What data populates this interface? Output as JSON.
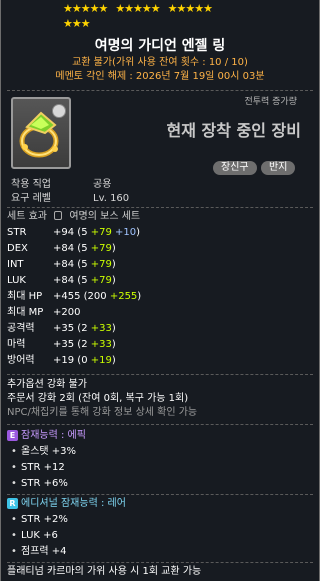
{
  "stars_row1": [
    "★★★★★",
    "★★★★★",
    "★★★★★"
  ],
  "stars_row2": "★★★",
  "item": {
    "name": "여명의 가디언 엔젤 링",
    "notice_trade": "교환 불가(가위 사용 잔여 횟수 : 10 / 10)",
    "notice_memento": "메멘토 각인 해제 : 2026년 7월 19일 00시 03분",
    "icon": "ring-icon"
  },
  "equip": {
    "power_label": "전투력 증가량",
    "status": "현재 장착 중인 장비",
    "tags": [
      "장신구",
      "반지"
    ]
  },
  "requirements": [
    {
      "label": "착용 직업",
      "value": "공용"
    },
    {
      "label": "요구 레벨",
      "value": "Lv. 160"
    }
  ],
  "set": {
    "label": "세트 효과",
    "name": "여명의 보스 세트"
  },
  "stats": [
    {
      "name": "STR",
      "total": "+94",
      "open": "(5 ",
      "extra": "+79",
      "sf": " +10",
      "close": ")"
    },
    {
      "name": "DEX",
      "total": "+84",
      "open": "(5 ",
      "extra": "+79",
      "sf": "",
      "close": ")"
    },
    {
      "name": "INT",
      "total": "+84",
      "open": "(5 ",
      "extra": "+79",
      "sf": "",
      "close": ")"
    },
    {
      "name": "LUK",
      "total": "+84",
      "open": "(5 ",
      "extra": "+79",
      "sf": "",
      "close": ")"
    },
    {
      "name": "최대 HP",
      "total": "+455",
      "open": "(200 ",
      "extra": "+255",
      "sf": "",
      "close": ")"
    },
    {
      "name": "최대 MP",
      "total": "+200",
      "open": "",
      "extra": "",
      "sf": "",
      "close": ""
    },
    {
      "name": "공격력",
      "total": "+35",
      "open": "(2 ",
      "extra": "+33",
      "sf": "",
      "close": ")"
    },
    {
      "name": "마력",
      "total": "+35",
      "open": "(2 ",
      "extra": "+33",
      "sf": "",
      "close": ")"
    },
    {
      "name": "방어력",
      "total": "+19",
      "open": "(0 ",
      "extra": "+19",
      "sf": "",
      "close": ")"
    }
  ],
  "info_lines": [
    "추가옵션 강화 불가",
    "주문서 강화 2회 (잔여 0회, 복구 가능 1회)",
    "NPC/채집키를 통해 강화 정보 상세 확인 가능"
  ],
  "potential": {
    "badge": "E",
    "title": "잠재능력 : 에픽",
    "lines": [
      "올스탯 +3%",
      "STR +12",
      "STR +6%"
    ]
  },
  "additional": {
    "badge": "R",
    "title": "에디셔널 잠재능력 : 레어",
    "lines": [
      "STR +2%",
      "LUK +6",
      "점프력 +4"
    ]
  },
  "footer": "플래티넘 카르마의 가위 사용 시 1회 교환 가능",
  "colors": {
    "epic": "#9b59e0",
    "rare": "#3ec3e6",
    "highlight": "#ccff00",
    "notice": "#ffb347"
  }
}
